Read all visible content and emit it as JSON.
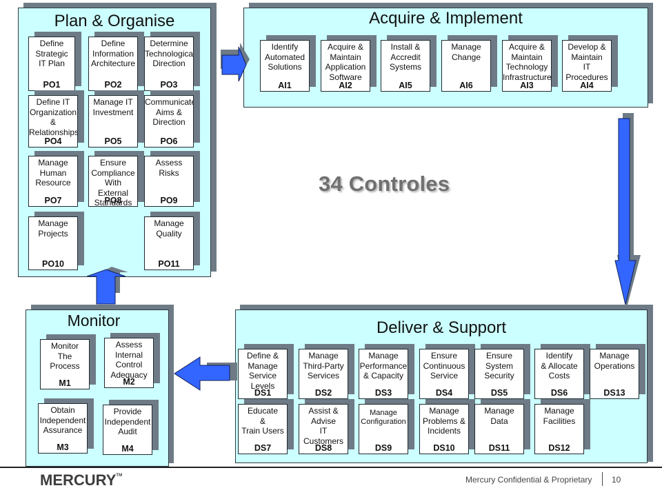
{
  "slide_title_center": "34 Controles",
  "plan_organise": {
    "title": "Plan & Organise",
    "boxes": [
      {
        "label": "Define\nStrategic\nIT Plan",
        "code": "PO1"
      },
      {
        "label": "Define\nInformation\nArchitecture",
        "code": "PO2"
      },
      {
        "label": "Determine\nTechnological\nDirection",
        "code": "PO3"
      },
      {
        "label": "Define IT\nOrganization\n&\nRelationships",
        "code": "PO4"
      },
      {
        "label": "Manage IT\nInvestment",
        "code": "PO5"
      },
      {
        "label": "Communicate\nAims &\nDirection",
        "code": "PO6"
      },
      {
        "label": "Manage\nHuman\nResource",
        "code": "PO7"
      },
      {
        "label": "Ensure\nCompliance\nWith External\nStandards",
        "code": "PO8"
      },
      {
        "label": "Assess\nRisks",
        "code": "PO9"
      },
      {
        "label": "Manage\nProjects",
        "code": "PO10"
      },
      {
        "label": "Manage\nQuality",
        "code": "PO11"
      }
    ]
  },
  "acquire_implement": {
    "title": "Acquire & Implement",
    "boxes": [
      {
        "label": "Identify\nAutomated\nSolutions",
        "code": "AI1"
      },
      {
        "label": "Acquire &\nMaintain\nApplication\nSoftware",
        "code": "AI2"
      },
      {
        "label": "Install &\nAccredit\nSystems",
        "code": "AI5"
      },
      {
        "label": "Manage\nChange",
        "code": "AI6"
      },
      {
        "label": "Acquire &\nMaintain\nTechnology\nInfrastructure",
        "code": "AI3"
      },
      {
        "label": "Develop &\nMaintain\nIT\nProcedures",
        "code": "AI4"
      }
    ]
  },
  "monitor": {
    "title": "Monitor",
    "boxes": [
      {
        "label": "Monitor\nThe\nProcess",
        "code": "M1"
      },
      {
        "label": "Assess\nInternal\nControl\nAdequacy",
        "code": "M2"
      },
      {
        "label": "Obtain\nIndependent\nAssurance",
        "code": "M3"
      },
      {
        "label": "Provide\nIndependent\nAudit",
        "code": "M4"
      }
    ]
  },
  "deliver_support": {
    "title": "Deliver & Support",
    "boxes": [
      {
        "label": "Define &\nManage\nService\nLevels",
        "code": "DS1"
      },
      {
        "label": "Manage\nThird-Party\nServices",
        "code": "DS2"
      },
      {
        "label": "Manage\nPerformance\n& Capacity",
        "code": "DS3"
      },
      {
        "label": "Ensure\nContinuous\nService",
        "code": "DS4"
      },
      {
        "label": "Ensure\nSystem\nSecurity",
        "code": "DS5"
      },
      {
        "label": "Identify\n& Allocate\nCosts",
        "code": "DS6"
      },
      {
        "label": "Manage\nOperations",
        "code": "DS13"
      },
      {
        "label": "Educate\n&\nTrain Users",
        "code": "DS7"
      },
      {
        "label": "Assist &\nAdvise\nIT\nCustomers",
        "code": "DS8"
      },
      {
        "label": "Manage\nConfiguration",
        "code": "DS9"
      },
      {
        "label": "Manage\nProblems &\nIncidents",
        "code": "DS10"
      },
      {
        "label": "Manage\nData",
        "code": "DS11"
      },
      {
        "label": "Manage\nFacilities",
        "code": "DS12"
      }
    ]
  },
  "footer": {
    "logo_text": "MERCURY",
    "logo_tm": "TM",
    "confidential": "Mercury Confidential & Proprietary",
    "page_number": "10"
  },
  "colors": {
    "panel_fill": "#ccffff",
    "shadow": "#6e7b86",
    "arrow_fill": "#3366ff",
    "controles_text": "#707070"
  }
}
